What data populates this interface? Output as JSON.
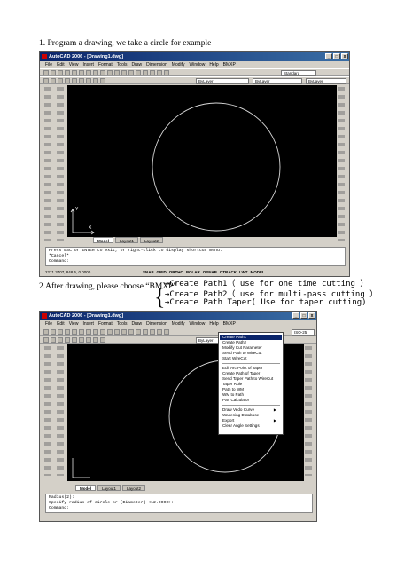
{
  "step1": "1. Program a drawing, we take a circle for example",
  "step2": "2.After drawing, please choose “BMXP”",
  "bracket": {
    "line1": "→Create Path1（ use for one time cutting ）",
    "line2": "→Create Path2（ use for multi-pass cutting ）",
    "line3": "→Create Path Taper( Use for taper cutting)"
  },
  "screen1": {
    "title": "AutoCAD 2006 - [Drawing1.dwg]",
    "menu": [
      "File",
      "Edit",
      "View",
      "Insert",
      "Format",
      "Tools",
      "Draw",
      "Dimension",
      "Modify",
      "Window",
      "Help",
      "BMXP"
    ],
    "layer_combo": "ByLayer",
    "linetype_combo": "ByLayer",
    "lineweight_combo": "ByLayer",
    "style_combo": "Standard",
    "tabs": [
      "Model",
      "Layout1",
      "Layout2"
    ],
    "command_lines": [
      "Press ESC or ENTER to exit, or right-click to display shortcut menu.",
      "*Cancel*",
      "Command:"
    ],
    "coords": "2271.3707, 848.5, 0.0000",
    "status_buttons": [
      "SNAP",
      "GRID",
      "ORTHO",
      "POLAR",
      "OSNAP",
      "OTRACK",
      "LWT",
      "MODEL"
    ]
  },
  "screen2": {
    "title": "AutoCAD 2006 - [Drawing1.dwg]",
    "menu": [
      "File",
      "Edit",
      "View",
      "Insert",
      "Format",
      "Tools",
      "Draw",
      "Dimension",
      "Modify",
      "Window",
      "Help",
      "BMXP"
    ],
    "layer_combo": "ByLayer",
    "style_combo": "ISO-25",
    "tabs": [
      "Model",
      "Layout1",
      "Layout2"
    ],
    "command_lines": [
      "Radius(2):",
      "Specify radius of circle or [Diameter] <12.0000>:",
      "Command:"
    ],
    "bmxp_menu": [
      {
        "label": "Create Path1",
        "highlight": true
      },
      {
        "label": "Create Path2"
      },
      {
        "label": "Modify Cut Parameter"
      },
      {
        "label": "Send Path to WireCut"
      },
      {
        "label": "Start WireCut"
      },
      {
        "sep": true
      },
      {
        "label": "Edit Arc Point of Taper"
      },
      {
        "label": "Create Path of Taper"
      },
      {
        "label": "Send Taper Path to WireCut"
      },
      {
        "label": "Taper Rule"
      },
      {
        "label": "Path to WM"
      },
      {
        "label": "WM to Path"
      },
      {
        "label": "Pan Calculator"
      },
      {
        "sep": true
      },
      {
        "label": "Draw Vedo Curve",
        "arrow": true
      },
      {
        "label": "Wakening Database"
      },
      {
        "label": "Export",
        "arrow": true
      },
      {
        "label": "Clear Angle Settings"
      }
    ]
  }
}
